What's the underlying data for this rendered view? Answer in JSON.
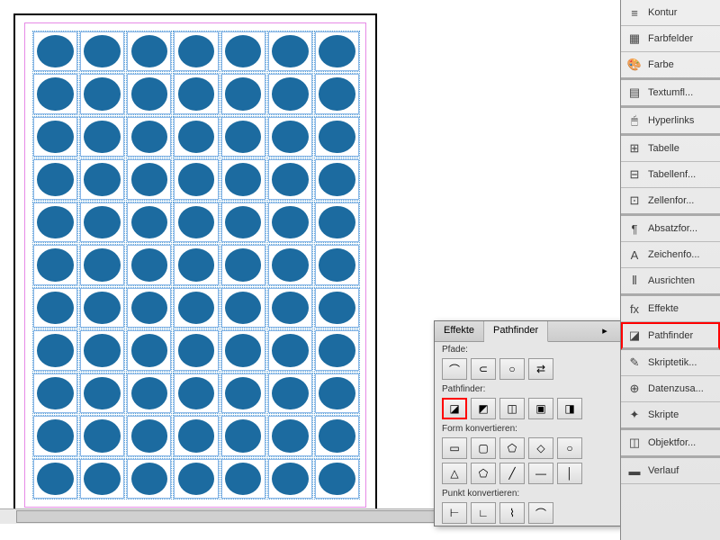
{
  "panels": {
    "kontur": "Kontur",
    "farbfelder": "Farbfelder",
    "farbe": "Farbe",
    "textumfl": "Textumfl...",
    "hyperlinks": "Hyperlinks",
    "tabelle": "Tabelle",
    "tabellenf": "Tabellenf...",
    "zellenfor": "Zellenfor...",
    "absatzfor": "Absatzfor...",
    "zeichenfo": "Zeichenfo...",
    "ausrichten": "Ausrichten",
    "effekte": "Effekte",
    "pathfinder": "Pathfinder",
    "skriptetik": "Skriptetik...",
    "datenzusa": "Datenzusa...",
    "skripte": "Skripte",
    "objektfor": "Objektfor...",
    "verlauf": "Verlauf"
  },
  "pf": {
    "tab_effekte": "Effekte",
    "tab_pathfinder": "Pathfinder",
    "sec_pfade": "Pfade:",
    "sec_pathfinder": "Pathfinder:",
    "sec_form": "Form konvertieren:",
    "sec_punkt": "Punkt konvertieren:"
  },
  "grid": {
    "cols": 7,
    "rows": 11
  }
}
